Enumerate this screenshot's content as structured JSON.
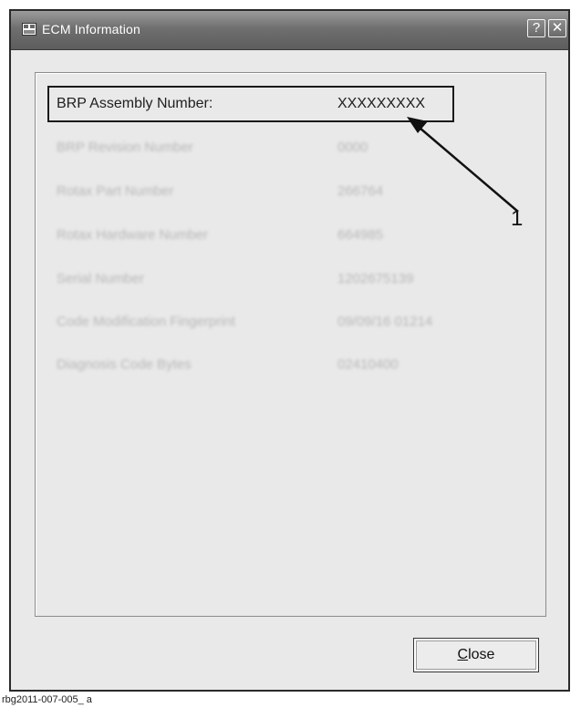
{
  "window": {
    "title": "ECM Information",
    "help_glyph": "?",
    "close_glyph": "✕"
  },
  "rows": [
    {
      "label": "BRP Assembly Number:",
      "value": "XXXXXXXXX"
    },
    {
      "label": "BRP Revision Number",
      "value": "0000"
    },
    {
      "label": "Rotax Part Number",
      "value": "266764"
    },
    {
      "label": "Rotax Hardware Number",
      "value": "664985"
    },
    {
      "label": "Serial Number",
      "value": "1202675139"
    },
    {
      "label": "Code Modification Fingerprint",
      "value": "09/09/16 01214"
    },
    {
      "label": "Diagnosis Code Bytes",
      "value": "02410400"
    }
  ],
  "callout": {
    "number": "1"
  },
  "footer": {
    "close_prefix": "C",
    "close_rest": "lose"
  },
  "caption": "rbg2011-007-005_ a",
  "icons": {
    "app": "ecm-window-icon",
    "help": "help-icon",
    "close": "close-icon"
  }
}
